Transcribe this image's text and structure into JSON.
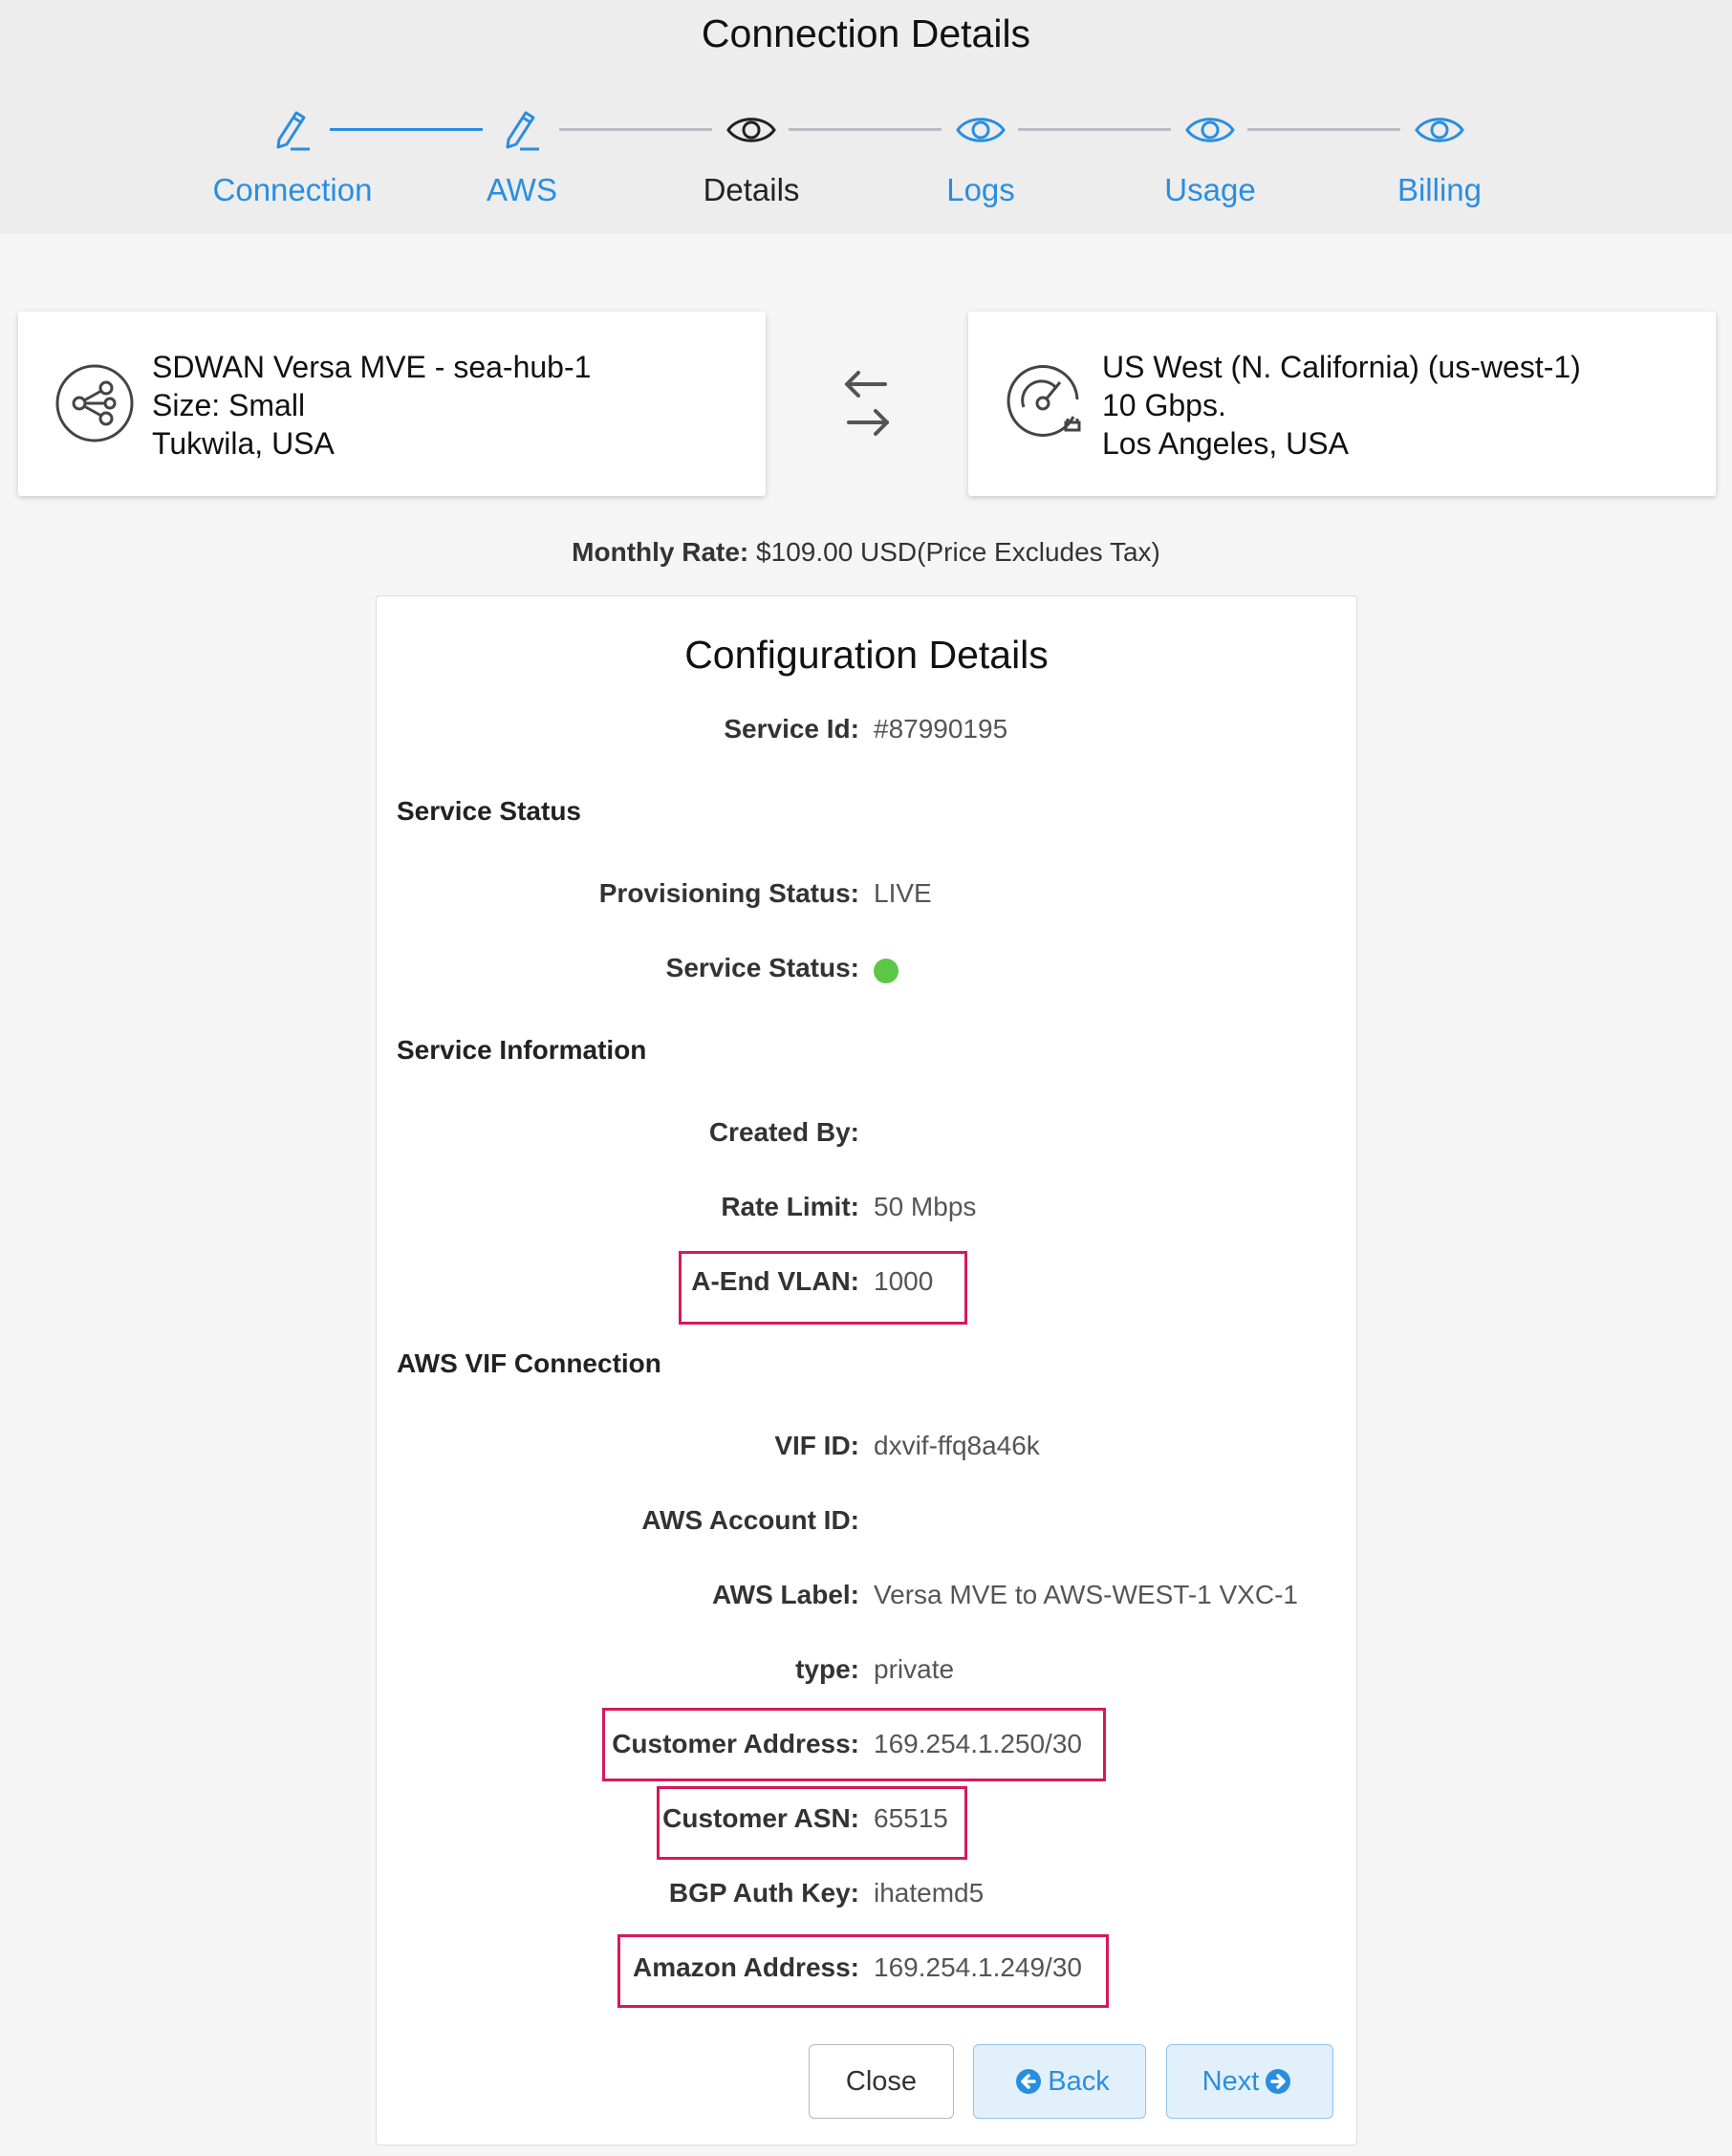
{
  "header": {
    "title": "Connection Details",
    "steps": [
      {
        "label": "Connection",
        "icon": "pencil-icon",
        "state": "done"
      },
      {
        "label": "AWS",
        "icon": "pencil-icon",
        "state": "done"
      },
      {
        "label": "Details",
        "icon": "eye-icon",
        "state": "current"
      },
      {
        "label": "Logs",
        "icon": "eye-icon",
        "state": "todo"
      },
      {
        "label": "Usage",
        "icon": "eye-icon",
        "state": "todo"
      },
      {
        "label": "Billing",
        "icon": "eye-icon",
        "state": "todo"
      }
    ]
  },
  "colors": {
    "accent": "#2a8ee0",
    "status_live": "#5cc646",
    "highlight": "#d51a57"
  },
  "a_end": {
    "icon": "share-nodes-icon",
    "name": "SDWAN Versa MVE - sea-hub-1",
    "size": "Size: Small",
    "location": "Tukwila, USA"
  },
  "b_end": {
    "icon": "speedometer-icon",
    "name": "US West (N. California) (us-west-1)",
    "speed": "10 Gbps.",
    "location": "Los Angeles, USA"
  },
  "rate": {
    "label": "Monthly Rate:",
    "value": "$109.00 USD(Price Excludes Tax)"
  },
  "config": {
    "title": "Configuration Details",
    "service_id": {
      "key": "Service Id:",
      "value": "#87990195"
    },
    "sections": {
      "status": "Service Status",
      "info": "Service Information",
      "aws": "AWS VIF Connection"
    },
    "provisioning_status": {
      "key": "Provisioning Status:",
      "value": "LIVE"
    },
    "service_status": {
      "key": "Service Status:",
      "state": "live"
    },
    "created_by": {
      "key": "Created By:",
      "value": ""
    },
    "rate_limit": {
      "key": "Rate Limit:",
      "value": "50 Mbps"
    },
    "a_end_vlan": {
      "key": "A-End VLAN:",
      "value": "1000"
    },
    "vif_id": {
      "key": "VIF ID:",
      "value": "dxvif-ffq8a46k"
    },
    "aws_account_id": {
      "key": "AWS Account ID:",
      "value": ""
    },
    "aws_label": {
      "key": "AWS Label:",
      "value": "Versa MVE to AWS-WEST-1 VXC-1"
    },
    "type": {
      "key": "type:",
      "value": "private"
    },
    "customer_address": {
      "key": "Customer Address:",
      "value": "169.254.1.250/30"
    },
    "customer_asn": {
      "key": "Customer ASN:",
      "value": "65515"
    },
    "bgp_auth_key": {
      "key": "BGP Auth Key:",
      "value": "ihatemd5"
    },
    "amazon_address": {
      "key": "Amazon Address:",
      "value": "169.254.1.249/30"
    }
  },
  "buttons": {
    "close": "Close",
    "back": "Back",
    "next": "Next"
  }
}
